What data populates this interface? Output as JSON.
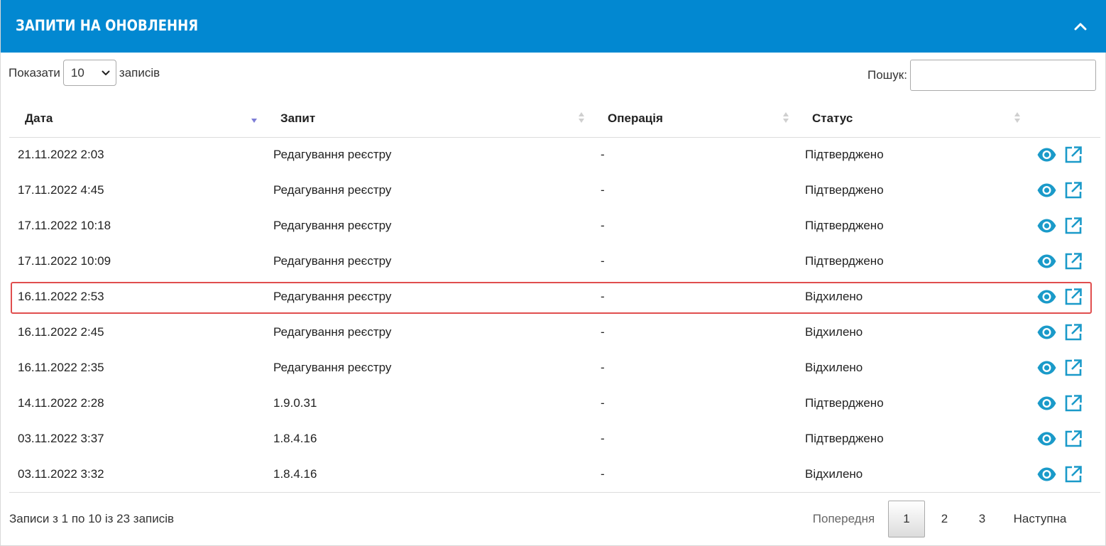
{
  "panel": {
    "title": "ЗАПИТИ НА ОНОВЛЕННЯ",
    "collapse_icon": "chevron-up-icon"
  },
  "controls": {
    "show_label": "Показати",
    "page_size": "10",
    "records_label": "записів",
    "search_label": "Пошук:",
    "search_value": ""
  },
  "table": {
    "headers": [
      "Дата",
      "Запит",
      "Операція",
      "Статус"
    ],
    "rows": [
      {
        "date": "21.11.2022 2:03",
        "request": "Редагування реєстру",
        "operation": "-",
        "status": "Підтверджено"
      },
      {
        "date": "17.11.2022 4:45",
        "request": "Редагування реєстру",
        "operation": "-",
        "status": "Підтверджено"
      },
      {
        "date": "17.11.2022 10:18",
        "request": "Редагування реєстру",
        "operation": "-",
        "status": "Підтверджено"
      },
      {
        "date": "17.11.2022 10:09",
        "request": "Редагування реєстру",
        "operation": "-",
        "status": "Підтверджено"
      },
      {
        "date": "16.11.2022 2:53",
        "request": "Редагування реєстру",
        "operation": "-",
        "status": "Відхилено"
      },
      {
        "date": "16.11.2022 2:45",
        "request": "Редагування реєстру",
        "operation": "-",
        "status": "Відхилено"
      },
      {
        "date": "16.11.2022 2:35",
        "request": "Редагування реєстру",
        "operation": "-",
        "status": "Відхилено"
      },
      {
        "date": "14.11.2022 2:28",
        "request": "1.9.0.31",
        "operation": "-",
        "status": "Підтверджено"
      },
      {
        "date": "03.11.2022 3:37",
        "request": "1.8.4.16",
        "operation": "-",
        "status": "Підтверджено"
      },
      {
        "date": "03.11.2022 3:32",
        "request": "1.8.4.16",
        "operation": "-",
        "status": "Відхилено"
      }
    ],
    "row_action_icons": [
      "eye-icon",
      "external-link-icon"
    ]
  },
  "footer": {
    "info": "Записи з 1 по 10 із 23 записів",
    "prev": "Попередня",
    "pages": [
      "1",
      "2",
      "3"
    ],
    "current_page": "1",
    "next": "Наступна"
  },
  "colors": {
    "header_bg": "#0288d1",
    "icon": "#1a9ac9",
    "highlight": "#e04e4e",
    "sort_active": "#7d7dd6",
    "sort_inactive": "#cfcfcf"
  }
}
